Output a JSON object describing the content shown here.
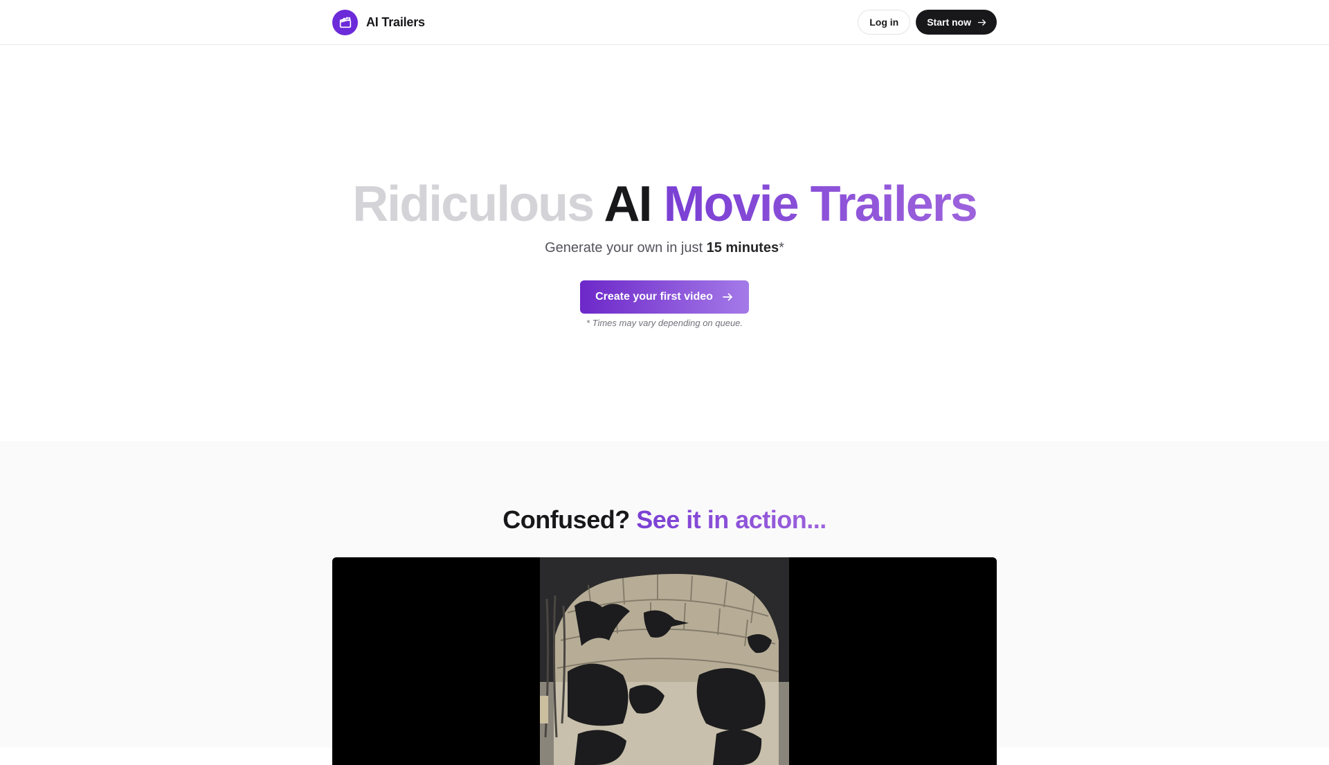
{
  "header": {
    "brand_name": "AI Trailers",
    "logo_icon": "clapperboard-icon",
    "login_label": "Log in",
    "start_label": "Start now"
  },
  "hero": {
    "title_part1": "Ridiculous",
    "title_part2": "AI",
    "title_part3": "Movie Trailers",
    "subtitle_prefix": "Generate your own in just",
    "subtitle_bold": "15 minutes",
    "subtitle_suffix": "*",
    "cta_label": "Create your first video",
    "disclaimer": "* Times may vary depending on queue."
  },
  "demo": {
    "title_question": "Confused?",
    "title_answer": "See it in action..."
  },
  "colors": {
    "brand_purple": "#6c2bd9",
    "accent_gradient_start": "#7a3fd4",
    "accent_gradient_end": "#9d63dc",
    "dark_button": "#18181b"
  }
}
